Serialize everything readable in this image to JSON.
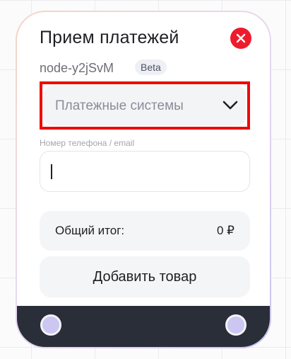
{
  "node": {
    "title": "Прием платежей",
    "node_id": "node-y2jSvM",
    "badge": "Beta"
  },
  "payment_select": {
    "value": "Платежные системы",
    "icon": "chevron-down-icon"
  },
  "contact_field": {
    "label": "Номер телефона / email",
    "value": ""
  },
  "total": {
    "label": "Общий итог:",
    "value": "0 ₽"
  },
  "add_button": {
    "label": "Добавить товар"
  },
  "icons": {
    "close": "close-icon",
    "input_handle": "connection-handle-icon",
    "output_handle": "connection-handle-icon"
  },
  "colors": {
    "close_button": "#ee1b2c",
    "highlight_border": "#ee0a0a",
    "footer": "#2a2e38",
    "handle": "#cbc6f2"
  }
}
